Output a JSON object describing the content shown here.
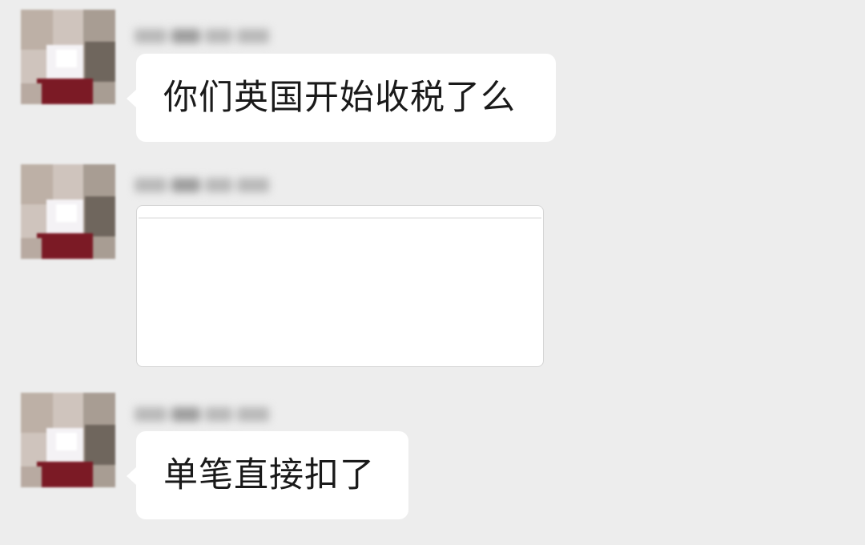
{
  "chat": {
    "messages": [
      {
        "type": "text",
        "text": "你们英国开始收税了么"
      },
      {
        "type": "card",
        "text": ""
      },
      {
        "type": "text",
        "text": "单笔直接扣了"
      }
    ]
  },
  "colors": {
    "background": "#ededed",
    "bubble": "#ffffff",
    "text": "#1a1a1a",
    "card_border": "#d4d4d4"
  },
  "icons": {
    "avatar": "pixelated-avatar-image",
    "sender_name": "blurred-sender-name"
  }
}
